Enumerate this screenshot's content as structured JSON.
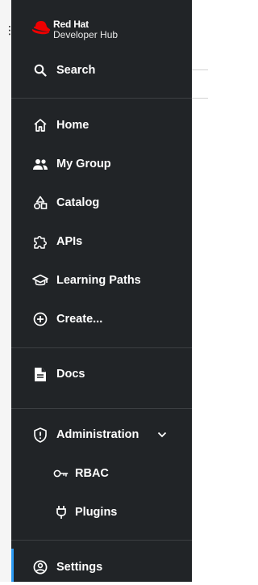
{
  "brand": {
    "line1": "Red Hat",
    "line2": "Developer Hub",
    "accent": "#ee0000"
  },
  "search": {
    "label": "Search",
    "icon": "search-icon"
  },
  "nav": {
    "home": {
      "label": "Home",
      "icon": "home-icon"
    },
    "my_group": {
      "label": "My Group",
      "icon": "group-icon"
    },
    "catalog": {
      "label": "Catalog",
      "icon": "shapes-icon"
    },
    "apis": {
      "label": "APIs",
      "icon": "puzzle-icon"
    },
    "learning_paths": {
      "label": "Learning Paths",
      "icon": "graduation-cap-icon"
    },
    "create": {
      "label": "Create...",
      "icon": "plus-circle-icon"
    },
    "docs": {
      "label": "Docs",
      "icon": "document-icon"
    },
    "administration": {
      "label": "Administration",
      "icon": "shield-icon",
      "expanded": true
    },
    "rbac": {
      "label": "RBAC",
      "icon": "key-icon"
    },
    "plugins": {
      "label": "Plugins",
      "icon": "plug-icon"
    },
    "settings": {
      "label": "Settings",
      "icon": "user-circle-icon",
      "active": true
    }
  },
  "colors": {
    "sidebar_bg": "#212427",
    "active_indicator": "#2b9af3",
    "text": "#ffffff"
  }
}
